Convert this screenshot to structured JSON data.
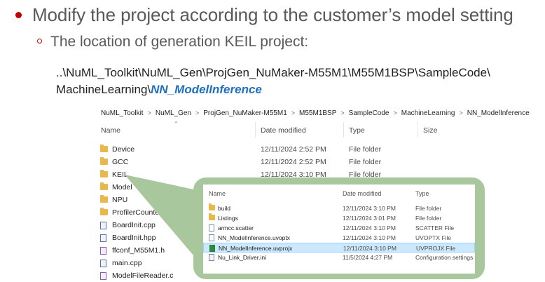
{
  "slide": {
    "bullet1": "Modify the project according to the customer’s model setting",
    "bullet2": "The location of generation KEIL project:",
    "path_line1": "..\\NuML_Toolkit\\NuML_Gen\\ProjGen_NuMaker-M55M1\\M55M1BSP\\SampleCode\\",
    "path_line2_prefix": "MachineLearning\\",
    "path_line2_highlight": "NN_ModelInference"
  },
  "colors": {
    "bullet": "#c00000",
    "highlight": "#1f6fc0",
    "callout": "#a9c79d",
    "selection": "#cce8ff"
  },
  "explorer": {
    "breadcrumb": [
      "NuML_Toolkit",
      "NuML_Gen",
      "ProjGen_NuMaker-M55M1",
      "M55M1BSP",
      "SampleCode",
      "MachineLearning",
      "NN_ModelInference"
    ],
    "breadcrumb_sep": ">",
    "columns": {
      "name": "Name",
      "date": "Date modified",
      "type": "Type",
      "size": "Size"
    },
    "rows": [
      {
        "name": "Device",
        "date": "12/11/2024 2:52 PM",
        "type": "File folder",
        "icon": "folder-icon"
      },
      {
        "name": "GCC",
        "date": "12/11/2024 2:52 PM",
        "type": "File folder",
        "icon": "folder-icon"
      },
      {
        "name": "KEIL",
        "date": "12/11/2024 3:10 PM",
        "type": "File folder",
        "icon": "folder-icon"
      },
      {
        "name": "Model",
        "date": "",
        "type": "",
        "icon": "folder-icon"
      },
      {
        "name": "NPU",
        "date": "",
        "type": "",
        "icon": "folder-icon"
      },
      {
        "name": "ProfilerCounter",
        "date": "",
        "type": "",
        "icon": "folder-icon"
      },
      {
        "name": "BoardInit.cpp",
        "date": "",
        "type": "",
        "icon": "cpp-file-icon"
      },
      {
        "name": "BoardInit.hpp",
        "date": "",
        "type": "",
        "icon": "hpp-file-icon"
      },
      {
        "name": "ffconf_M55M1.h",
        "date": "",
        "type": "",
        "icon": "header-file-icon"
      },
      {
        "name": "main.cpp",
        "date": "",
        "type": "",
        "icon": "cpp-file-icon"
      },
      {
        "name": "ModelFileReader.c",
        "date": "",
        "type": "",
        "icon": "c-file-icon"
      }
    ]
  },
  "keil_view": {
    "columns": {
      "name": "Name",
      "date": "Date modified",
      "type": "Type"
    },
    "rows": [
      {
        "name": "build",
        "date": "12/11/2024 3:10 PM",
        "type": "File folder",
        "icon": "folder-icon"
      },
      {
        "name": "Listings",
        "date": "12/11/2024 3:01 PM",
        "type": "File folder",
        "icon": "folder-icon"
      },
      {
        "name": "armcc.scatter",
        "date": "12/11/2024 3:10 PM",
        "type": "SCATTER File",
        "icon": "file-icon"
      },
      {
        "name": "NN_ModelInference.uvoptx",
        "date": "12/11/2024 3:10 PM",
        "type": "UVOPTX File",
        "icon": "file-icon"
      },
      {
        "name": "NN_ModelInference.uvprojx",
        "date": "12/11/2024 3:10 PM",
        "type": "UVPROJX File",
        "icon": "uvprojx-icon",
        "selected": true
      },
      {
        "name": "Nu_Link_Driver.ini",
        "date": "11/5/2024 4:27 PM",
        "type": "Configuration settings",
        "icon": "ini-file-icon"
      }
    ]
  }
}
